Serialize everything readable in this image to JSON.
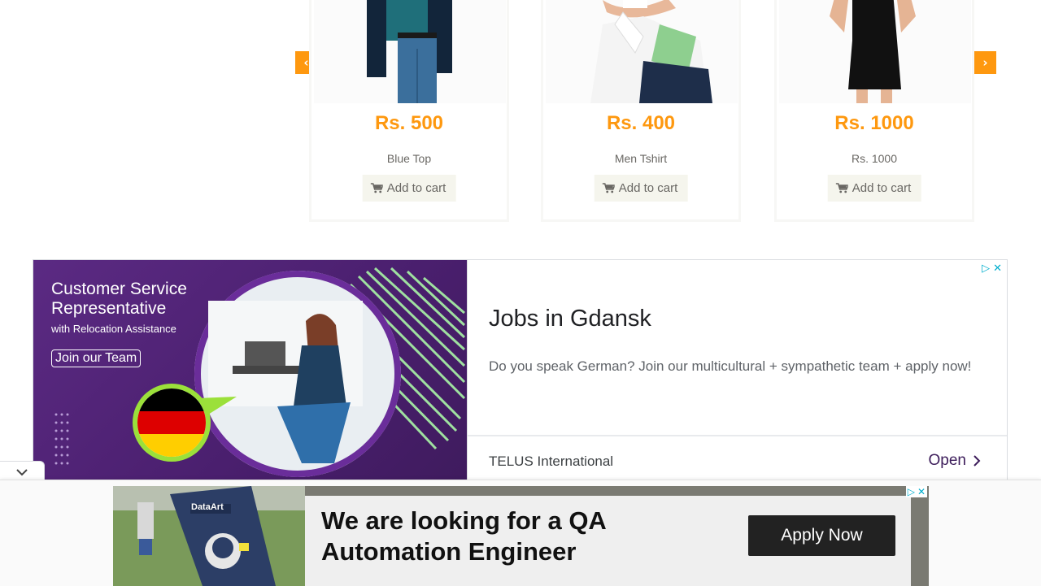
{
  "carousel": {
    "products": [
      {
        "price": "Rs. 500",
        "name": "Blue Top",
        "button": "Add to cart"
      },
      {
        "price": "Rs. 400",
        "name": "Men Tshirt",
        "button": "Add to cart"
      },
      {
        "price": "Rs. 1000",
        "name": "Rs. 1000",
        "button": "Add to cart"
      }
    ]
  },
  "ad1": {
    "image_title_line1": "Customer Service",
    "image_title_line2": "Representative",
    "image_subtitle": "with Relocation Assistance",
    "image_cta": "Join our Team",
    "headline": "Jobs in Gdansk",
    "body": "Do you speak German? Join our multicultural + sympathetic team + apply now!",
    "advertiser": "TELUS International",
    "open_label": "Open"
  },
  "ad2": {
    "photo_brand": "DataArt",
    "message": "We are looking for a QA Automation Engineer",
    "cta": "Apply Now"
  },
  "colors": {
    "accent": "#FE980F",
    "ad_purple": "#5b2a83",
    "adchoices": "#00aecd"
  }
}
